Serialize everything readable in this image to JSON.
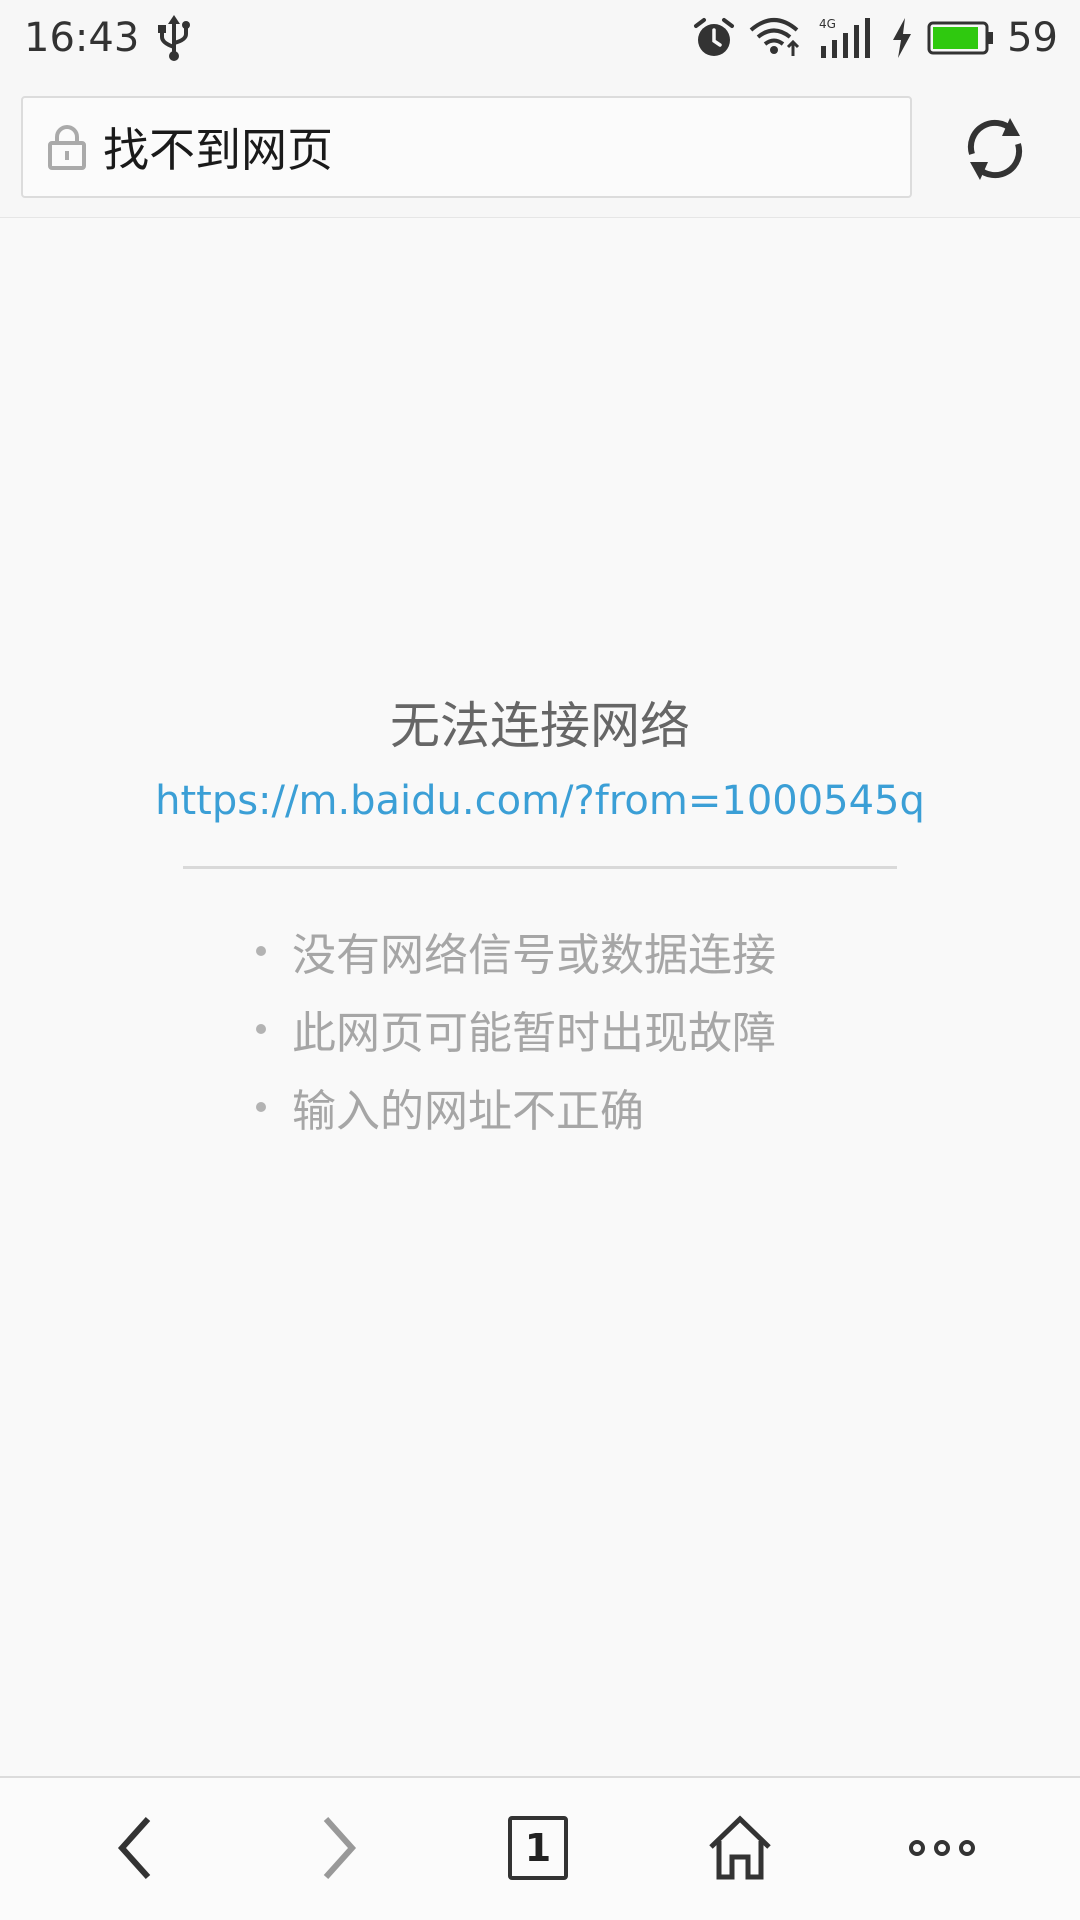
{
  "status_bar": {
    "time": "16:43",
    "network_type": "4G",
    "battery_percent": "59",
    "battery_fill_fraction": 0.9,
    "battery_color": "#2fc90f",
    "icons": [
      "usb-icon",
      "alarm-icon",
      "wifi-icon",
      "signal-icon",
      "charging-icon",
      "battery-icon"
    ]
  },
  "address_bar": {
    "title": "找不到网页",
    "lock_icon": "lock-icon",
    "refresh_icon": "refresh-icon"
  },
  "error": {
    "title": "无法连接网络",
    "url": "https://m.baidu.com/?from=1000545q",
    "url_color": "#3b9fd6",
    "reasons": [
      "没有网络信号或数据连接",
      "此网页可能暂时出现故障",
      "输入的网址不正确"
    ]
  },
  "bottom_nav": {
    "tab_count": "1",
    "icons": [
      "back-icon",
      "forward-icon",
      "tabs-icon",
      "home-icon",
      "more-icon"
    ]
  }
}
